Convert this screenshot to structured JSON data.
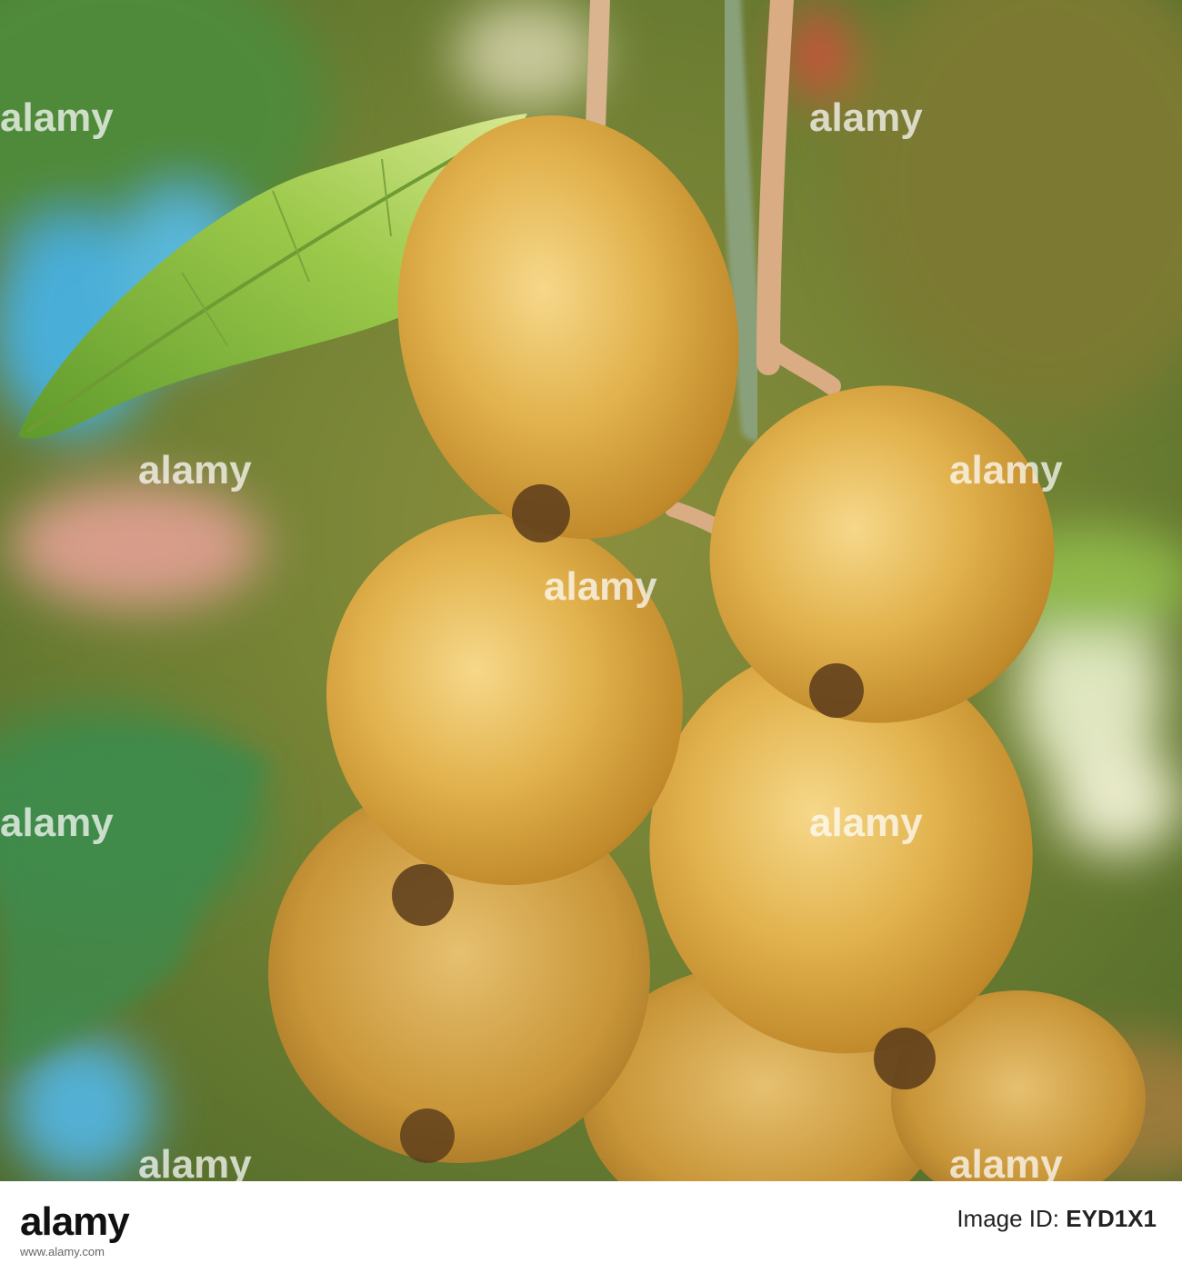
{
  "watermark": {
    "text": "alamy"
  },
  "footer": {
    "logo_text": "alamy",
    "image_id_label": "Image ID:",
    "image_id": "EYD1X1",
    "url": "www.alamy.com"
  },
  "colors": {
    "kiwi_skin": "#c89a2e",
    "kiwi_highlight": "#f3d27a",
    "leaf": "#8fbf3f",
    "background_green": "#6f8a35",
    "accent_blue": "#4ab2d6",
    "accent_pink": "#d88a7a"
  }
}
